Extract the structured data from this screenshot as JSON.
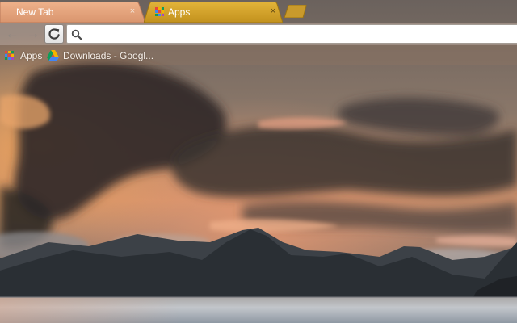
{
  "theme": {
    "accent_gold": "#d19f26",
    "tab_peach": "#e6a27a",
    "sky_sunset": "#d9916a",
    "cloud_dark": "#3b3330",
    "lake_light": "#bcc2c8"
  },
  "tabs": [
    {
      "title": "New Tab",
      "active": true,
      "close_glyph": "×"
    },
    {
      "title": "Apps",
      "active": false,
      "close_glyph": "×",
      "favicon": "apps-grid-icon"
    }
  ],
  "toolbar": {
    "back_glyph": "←",
    "forward_glyph": "→",
    "reload_icon": "reload-icon",
    "omnibox": {
      "value": "",
      "placeholder": "",
      "icon": "search-icon"
    }
  },
  "bookmarks": [
    {
      "label": "Apps",
      "icon": "apps-grid-icon"
    },
    {
      "label": "Downloads - Googl...",
      "icon": "google-drive-icon"
    }
  ],
  "apps_grid_colors": [
    "#e8453c",
    "#f4b400",
    "#0f9d58",
    "#4285f4",
    "#e8453c",
    "#f4b400",
    "#0f9d58",
    "#4285f4",
    "#ab47bc"
  ]
}
